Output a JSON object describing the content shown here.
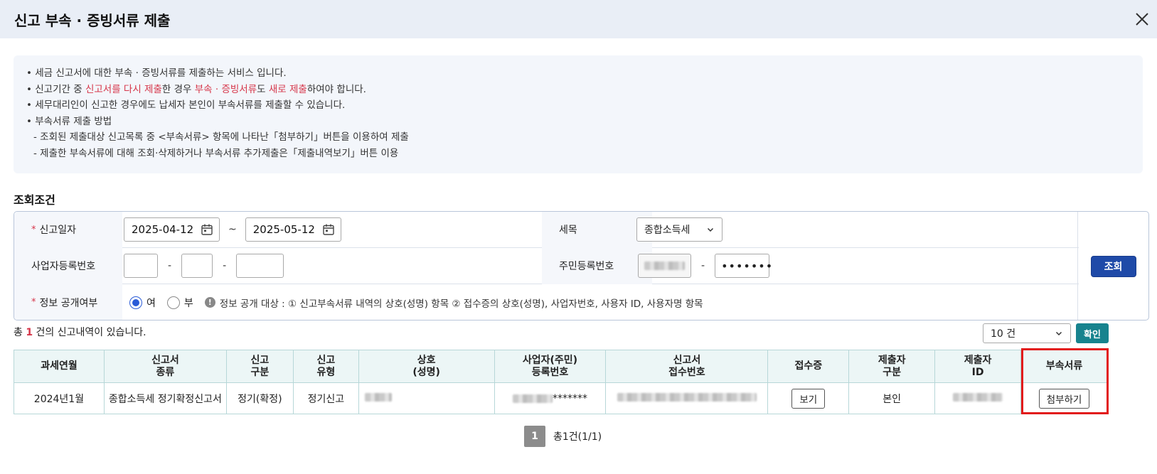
{
  "dialog": {
    "title": "신고 부속 · 증빙서류 제출",
    "close_icon": "close-icon"
  },
  "info": {
    "line1": "• 세금 신고서에 대한 부속 · 증빙서류를 제출하는 서비스 입니다.",
    "line2": {
      "p1": "• 신고기간 중 ",
      "p2": "신고서를 다시 제출",
      "p3": "한 경우 ",
      "p4": "부속 · 증빙서류",
      "p5": "도 ",
      "p6": "새로 제출",
      "p7": "하여야 합니다."
    },
    "line3": "• 세무대리인이 신고한 경우에도 납세자 본인이 부속서류를 제출할 수 있습니다.",
    "line4": "• 부속서류 제출 방법",
    "line5": "- 조회된 제출대상 신고목록 중 <부속서류> 항목에 나타난「첨부하기」버튼을 이용하여 제출",
    "line6": "- 제출한 부속서류에 대해 조회·삭제하거나 부속서류 추가제출은「제출내역보기」버튼 이용"
  },
  "search": {
    "section_title": "조회조건",
    "report_date_label": "신고일자",
    "required_mark": "*",
    "date_from": "2025-04-12",
    "date_to": "2025-05-12",
    "tilde": "~",
    "tax_item_label": "세목",
    "tax_item_value": "종합소득세",
    "biz_no_label": "사업자등록번호",
    "resident_no_label": "주민등록번호",
    "resident_no_back": "•••••••",
    "dash": "-",
    "disclosure_label": "정보 공개여부",
    "radio_yes": "여",
    "radio_no": "부",
    "disclosure_notice": "정보 공개 대상 : ① 신고부속서류 내역의 상호(성명) 항목 ② 접수증의 상호(성명), 사업자번호, 사용자 ID, 사용자명 항목",
    "search_button": "조회"
  },
  "results": {
    "total_prefix": "총 ",
    "total_count": "1",
    "total_suffix": " 건의 신고내역이 있습니다.",
    "page_size": "10 건",
    "confirm_button": "확인",
    "columns": {
      "c1": "과세연월",
      "c2a": "신고서",
      "c2b": "종류",
      "c3a": "신고",
      "c3b": "구분",
      "c4a": "신고",
      "c4b": "유형",
      "c5a": "상호",
      "c5b": "(성명)",
      "c6a": "사업자(주민)",
      "c6b": "등록번호",
      "c7a": "신고서",
      "c7b": "접수번호",
      "c8": "접수증",
      "c9a": "제출자",
      "c9b": "구분",
      "c10a": "제출자",
      "c10b": "ID",
      "c11": "부속서류"
    },
    "rows": [
      {
        "period": "2024년1월",
        "form_type": "종합소득세 정기확정신고서",
        "report_class": "정기(확정)",
        "report_type": "정기신고",
        "reg_no_mask": "*******",
        "receipt_button": "보기",
        "submitter_type": "본인",
        "attach_button": "첨부하기"
      }
    ],
    "pager": {
      "current": "1",
      "info": "총1건(1/1)"
    }
  },
  "colors": {
    "primary": "#1f4aa8",
    "teal": "#17838e",
    "red": "#d6364a",
    "highlight": "#e21b1b"
  }
}
